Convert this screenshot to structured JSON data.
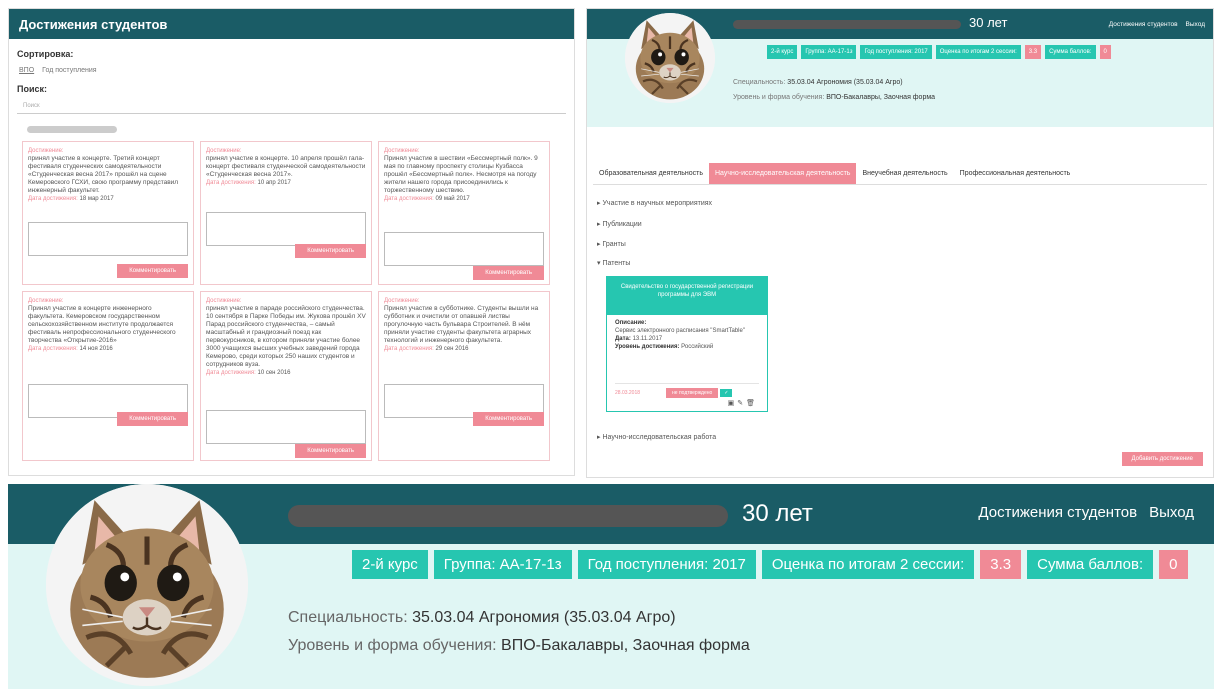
{
  "left_panel": {
    "title": "Достижения студентов",
    "sort_label": "Сортировка:",
    "sort_options": [
      "ВПО",
      "Год поступления"
    ],
    "search_label": "Поиск:",
    "search_placeholder": "Поиск",
    "achievements": [
      {
        "title": "Достижение:",
        "text": "принял участие в концерте. Третий концерт фестиваля студенческих самодеятельности «Студенческая весна 2017» прошёл на сцене Кемеровского ГСХИ, свою программу представил инженерный факультет.",
        "date_label": "Дата достижения:",
        "date": "18 мар 2017",
        "comment_btn": "Комментировать"
      },
      {
        "title": "Достижение:",
        "text": "принял участие в концерте. 10 апреля прошёл гала-концерт фестиваля студенческой самодеятельности «Студенческая весна 2017».",
        "date_label": "Дата достижения:",
        "date": "10 апр 2017",
        "comment_btn": "Комментировать"
      },
      {
        "title": "Достижение:",
        "text": "Принял участие в шествии «Бессмертный полк». 9 мая по главному проспекту столицы Кузбасса прошёл «Бессмертный полк». Несмотря на погоду жители нашего города присоединились к торжественному шествию.",
        "date_label": "Дата достижения:",
        "date": "09 май 2017",
        "comment_btn": "Комментировать"
      },
      {
        "title": "Достижение:",
        "text": "Принял участие в концерте инженерного факультета. Кемеровском государственном сельскохозяйственном институте продолжается фестиваль непрофессионального студенческого творчества «Открытие-2016»",
        "date_label": "Дата достижения:",
        "date": "14 ноя 2016",
        "comment_btn": "Комментировать"
      },
      {
        "title": "Достижение:",
        "text": "принял участие в параде российского студенчества. 10 сентября в Парке Победы им. Жукова прошёл XV Парад российского студенчества, – самый масштабный и грандиозный поезд как первокурсников, в котором приняли участие более 3000 учащихся высших учебных заведений города Кемерово, среди которых 250 наших студентов и сотрудников вуза.",
        "date_label": "Дата достижения:",
        "date": "10 сен 2016",
        "comment_btn": "Комментировать"
      },
      {
        "title": "Достижение:",
        "text": "Принял участие в субботнике. Студенты вышли на субботник и очистили от опавшей листвы прогулочную часть бульвара Строителей. В нём приняли участие студенты факультета аграрных технологий и инженерного факультета.",
        "date_label": "Дата достижения:",
        "date": "29 сен 2016",
        "comment_btn": "Комментировать"
      }
    ]
  },
  "right_panel": {
    "age": "30 лет",
    "nav": [
      "Достижения студентов",
      "Выход"
    ],
    "badges": [
      {
        "label": "2-й курс",
        "kind": "teal"
      },
      {
        "label": "Группа: АА-17-1з",
        "kind": "teal"
      },
      {
        "label": "Год поступления: 2017",
        "kind": "teal"
      },
      {
        "label": "Оценка по итогам 2 сессии:",
        "kind": "teal"
      },
      {
        "label": "3.3",
        "kind": "pink"
      },
      {
        "label": "Сумма баллов:",
        "kind": "teal"
      },
      {
        "label": "0",
        "kind": "pink"
      }
    ],
    "spec_label": "Специальность:",
    "spec_value": "35.03.04 Агрономия (35.03.04 Агро)",
    "level_label": "Уровень и форма обучения:",
    "level_value": "ВПО-Бакалавры, Заочная форма",
    "tabs": [
      "Образовательная деятельность",
      "Научно-исследовательская деятельность",
      "Внеучебная деятельность",
      "Профессиональная деятельность"
    ],
    "active_tab": 1,
    "accordion": [
      "Участие в научных мероприятиях",
      "Публикации",
      "Гранты",
      "Патенты",
      "Научно-исследовательская работа"
    ],
    "patent": {
      "title": "Свидетельство о государственной регистрации программы для ЭВМ",
      "desc_label": "Описание:",
      "desc": "Сервис электронного расписания \"SmartTable\"",
      "date_label": "Дата:",
      "date": "13.11.2017",
      "level_label": "Уровень достижения:",
      "level": "Российский",
      "footer_date": "28.03.2018",
      "status": "не подтверждено"
    },
    "add_btn": "Добавить достижение"
  },
  "bottom_panel": {
    "age": "30 лет",
    "nav": [
      "Достижения студентов",
      "Выход"
    ],
    "badges": [
      {
        "label": "2-й курс",
        "kind": "teal"
      },
      {
        "label": "Группа: АА-17-1з",
        "kind": "teal"
      },
      {
        "label": "Год поступления: 2017",
        "kind": "teal"
      },
      {
        "label": "Оценка по итогам 2 сессии:",
        "kind": "teal"
      },
      {
        "label": "3.3",
        "kind": "pink"
      },
      {
        "label": "Сумма баллов:",
        "kind": "teal"
      },
      {
        "label": "0",
        "kind": "pink"
      }
    ],
    "spec_label": "Специальность:",
    "spec_value": "35.03.04 Агрономия (35.03.04 Агро)",
    "level_label": "Уровень и форма обучения:",
    "level_value": "ВПО-Бакалавры, Заочная форма"
  },
  "colors": {
    "header_teal": "#1a5c66",
    "badge_teal": "#26c6b0",
    "accent_pink": "#f08a96",
    "info_bg": "#e0f6f4"
  }
}
